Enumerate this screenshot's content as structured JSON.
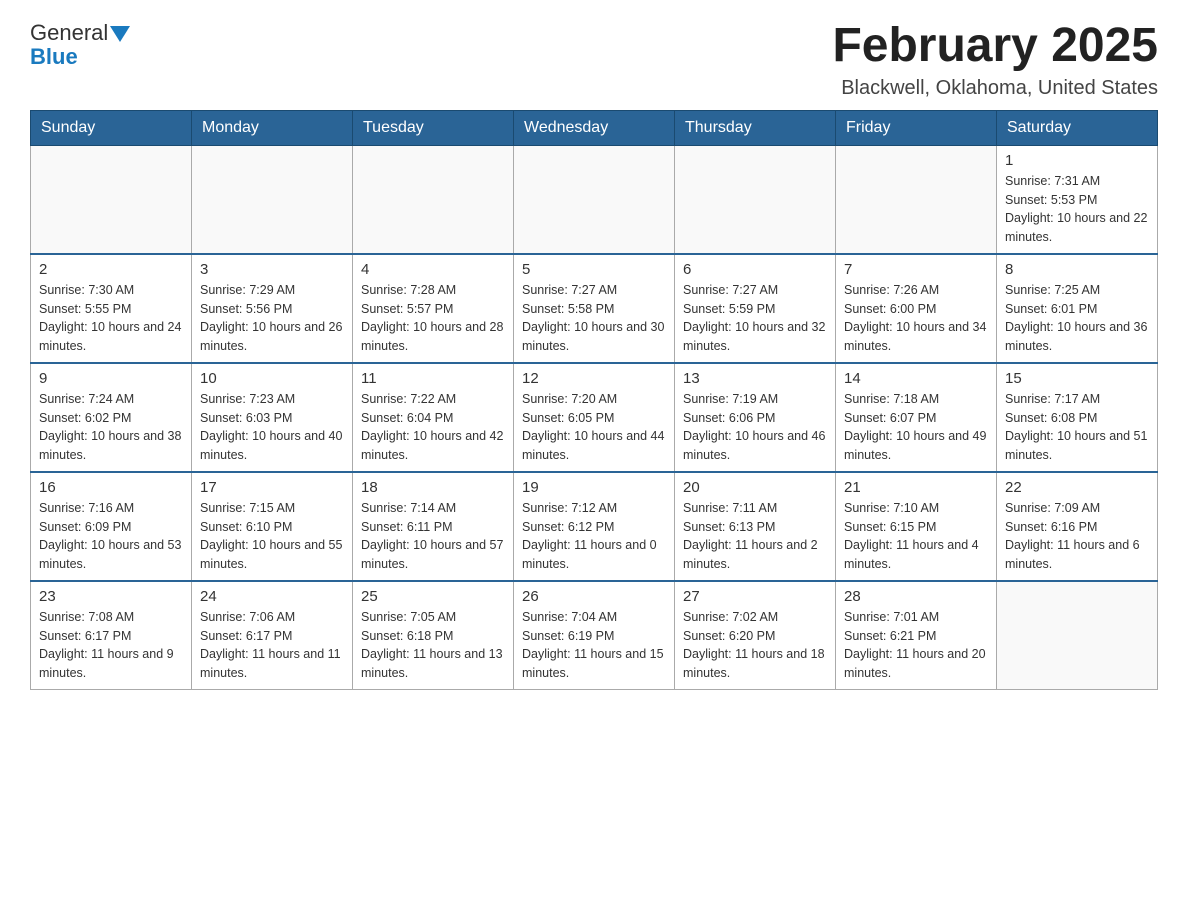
{
  "header": {
    "logo": {
      "text_general": "General",
      "text_blue": "Blue",
      "arrow": "▼"
    },
    "title": "February 2025",
    "subtitle": "Blackwell, Oklahoma, United States"
  },
  "days_of_week": [
    "Sunday",
    "Monday",
    "Tuesday",
    "Wednesday",
    "Thursday",
    "Friday",
    "Saturday"
  ],
  "weeks": [
    {
      "days": [
        {
          "num": "",
          "info": ""
        },
        {
          "num": "",
          "info": ""
        },
        {
          "num": "",
          "info": ""
        },
        {
          "num": "",
          "info": ""
        },
        {
          "num": "",
          "info": ""
        },
        {
          "num": "",
          "info": ""
        },
        {
          "num": "1",
          "info": "Sunrise: 7:31 AM\nSunset: 5:53 PM\nDaylight: 10 hours and 22 minutes."
        }
      ]
    },
    {
      "days": [
        {
          "num": "2",
          "info": "Sunrise: 7:30 AM\nSunset: 5:55 PM\nDaylight: 10 hours and 24 minutes."
        },
        {
          "num": "3",
          "info": "Sunrise: 7:29 AM\nSunset: 5:56 PM\nDaylight: 10 hours and 26 minutes."
        },
        {
          "num": "4",
          "info": "Sunrise: 7:28 AM\nSunset: 5:57 PM\nDaylight: 10 hours and 28 minutes."
        },
        {
          "num": "5",
          "info": "Sunrise: 7:27 AM\nSunset: 5:58 PM\nDaylight: 10 hours and 30 minutes."
        },
        {
          "num": "6",
          "info": "Sunrise: 7:27 AM\nSunset: 5:59 PM\nDaylight: 10 hours and 32 minutes."
        },
        {
          "num": "7",
          "info": "Sunrise: 7:26 AM\nSunset: 6:00 PM\nDaylight: 10 hours and 34 minutes."
        },
        {
          "num": "8",
          "info": "Sunrise: 7:25 AM\nSunset: 6:01 PM\nDaylight: 10 hours and 36 minutes."
        }
      ]
    },
    {
      "days": [
        {
          "num": "9",
          "info": "Sunrise: 7:24 AM\nSunset: 6:02 PM\nDaylight: 10 hours and 38 minutes."
        },
        {
          "num": "10",
          "info": "Sunrise: 7:23 AM\nSunset: 6:03 PM\nDaylight: 10 hours and 40 minutes."
        },
        {
          "num": "11",
          "info": "Sunrise: 7:22 AM\nSunset: 6:04 PM\nDaylight: 10 hours and 42 minutes."
        },
        {
          "num": "12",
          "info": "Sunrise: 7:20 AM\nSunset: 6:05 PM\nDaylight: 10 hours and 44 minutes."
        },
        {
          "num": "13",
          "info": "Sunrise: 7:19 AM\nSunset: 6:06 PM\nDaylight: 10 hours and 46 minutes."
        },
        {
          "num": "14",
          "info": "Sunrise: 7:18 AM\nSunset: 6:07 PM\nDaylight: 10 hours and 49 minutes."
        },
        {
          "num": "15",
          "info": "Sunrise: 7:17 AM\nSunset: 6:08 PM\nDaylight: 10 hours and 51 minutes."
        }
      ]
    },
    {
      "days": [
        {
          "num": "16",
          "info": "Sunrise: 7:16 AM\nSunset: 6:09 PM\nDaylight: 10 hours and 53 minutes."
        },
        {
          "num": "17",
          "info": "Sunrise: 7:15 AM\nSunset: 6:10 PM\nDaylight: 10 hours and 55 minutes."
        },
        {
          "num": "18",
          "info": "Sunrise: 7:14 AM\nSunset: 6:11 PM\nDaylight: 10 hours and 57 minutes."
        },
        {
          "num": "19",
          "info": "Sunrise: 7:12 AM\nSunset: 6:12 PM\nDaylight: 11 hours and 0 minutes."
        },
        {
          "num": "20",
          "info": "Sunrise: 7:11 AM\nSunset: 6:13 PM\nDaylight: 11 hours and 2 minutes."
        },
        {
          "num": "21",
          "info": "Sunrise: 7:10 AM\nSunset: 6:15 PM\nDaylight: 11 hours and 4 minutes."
        },
        {
          "num": "22",
          "info": "Sunrise: 7:09 AM\nSunset: 6:16 PM\nDaylight: 11 hours and 6 minutes."
        }
      ]
    },
    {
      "days": [
        {
          "num": "23",
          "info": "Sunrise: 7:08 AM\nSunset: 6:17 PM\nDaylight: 11 hours and 9 minutes."
        },
        {
          "num": "24",
          "info": "Sunrise: 7:06 AM\nSunset: 6:17 PM\nDaylight: 11 hours and 11 minutes."
        },
        {
          "num": "25",
          "info": "Sunrise: 7:05 AM\nSunset: 6:18 PM\nDaylight: 11 hours and 13 minutes."
        },
        {
          "num": "26",
          "info": "Sunrise: 7:04 AM\nSunset: 6:19 PM\nDaylight: 11 hours and 15 minutes."
        },
        {
          "num": "27",
          "info": "Sunrise: 7:02 AM\nSunset: 6:20 PM\nDaylight: 11 hours and 18 minutes."
        },
        {
          "num": "28",
          "info": "Sunrise: 7:01 AM\nSunset: 6:21 PM\nDaylight: 11 hours and 20 minutes."
        },
        {
          "num": "",
          "info": ""
        }
      ]
    }
  ]
}
